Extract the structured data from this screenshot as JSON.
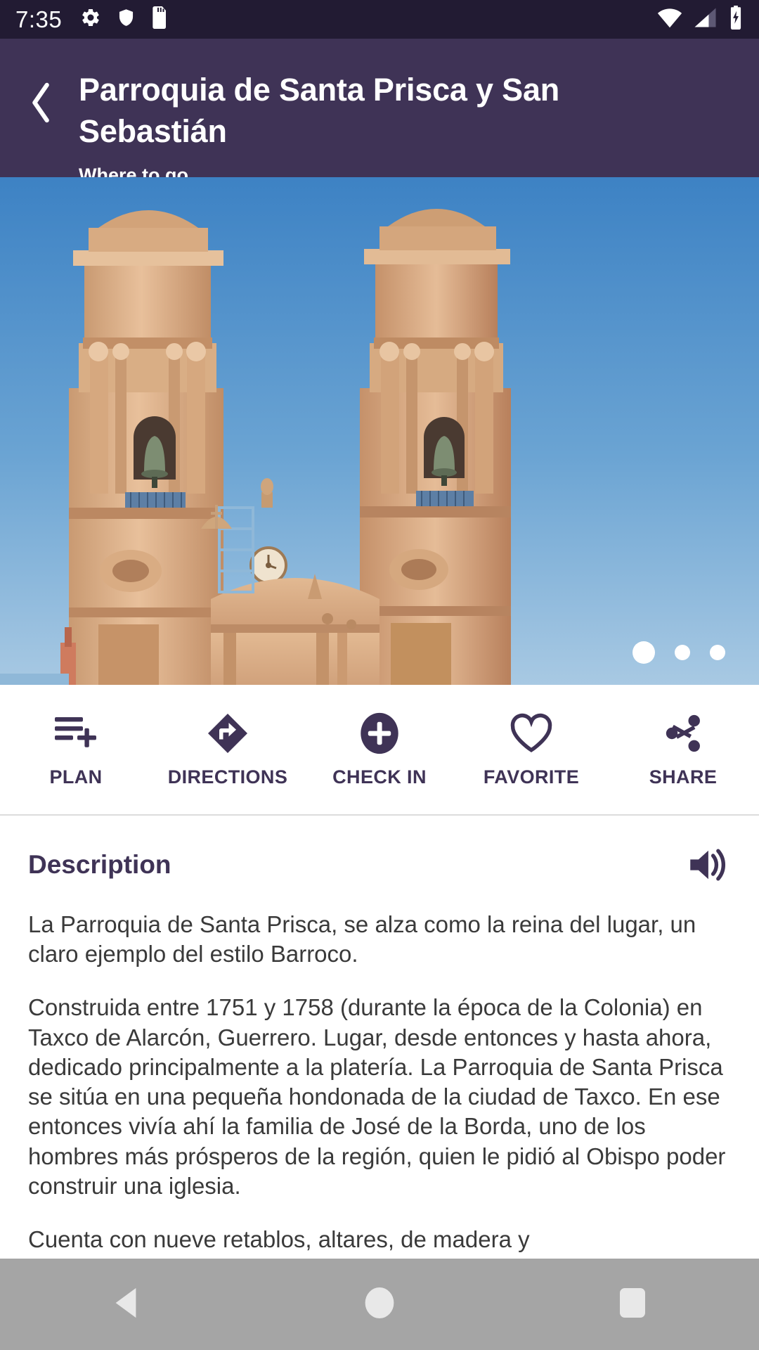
{
  "status_bar": {
    "time": "7:35",
    "left_icons": [
      "gear-icon",
      "shield-icon",
      "sd-card-icon"
    ],
    "right_icons": [
      "wifi-icon",
      "cell-signal-icon",
      "battery-charging-icon"
    ],
    "background": "#221B33"
  },
  "app_bar": {
    "back_icon": "chevron-left-icon",
    "title": "Parroquia de Santa Prisca y San Sebastián",
    "subtitle": "Where to go",
    "background": "#3F3356"
  },
  "hero": {
    "alt": "Baroque stone bell towers of Santa Prisca church against a clear blue sky",
    "carousel": {
      "total": 3,
      "active_index": 0
    }
  },
  "actions": [
    {
      "label": "PLAN",
      "icon": "playlist-add-icon"
    },
    {
      "label": "DIRECTIONS",
      "icon": "directions-icon"
    },
    {
      "label": "CHECK IN",
      "icon": "add-circle-icon"
    },
    {
      "label": "FAVORITE",
      "icon": "heart-outline-icon"
    },
    {
      "label": "SHARE",
      "icon": "share-icon"
    }
  ],
  "description": {
    "heading": "Description",
    "speaker_icon": "volume-up-icon",
    "paragraphs": [
      "La Parroquia de Santa Prisca, se alza como la reina del lugar, un claro ejemplo del estilo Barroco.",
      "Construida entre 1751 y 1758 (durante la época de la Colonia) en Taxco de Alarcón, Guerrero. Lugar, desde entonces y hasta ahora, dedicado principalmente a la platería. La Parroquia de Santa Prisca se sitúa en una pequeña hondonada de la ciudad de Taxco. En ese entonces vivía ahí la familia de José de la Borda, uno de los hombres más prósperos de la región, quien le pidió al Obispo poder construir una iglesia.",
      "Cuenta con nueve retablos, altares, de madera y"
    ]
  },
  "nav_bar": {
    "buttons": [
      {
        "name": "back-button",
        "icon": "triangle-back-icon"
      },
      {
        "name": "home-button",
        "icon": "circle-home-icon"
      },
      {
        "name": "recents-button",
        "icon": "square-recents-icon"
      }
    ]
  },
  "colors": {
    "brand_purple": "#3F3356",
    "status_bar_dark": "#221B33",
    "body_text": "#3a3a3a",
    "divider": "#dcdcdc"
  }
}
